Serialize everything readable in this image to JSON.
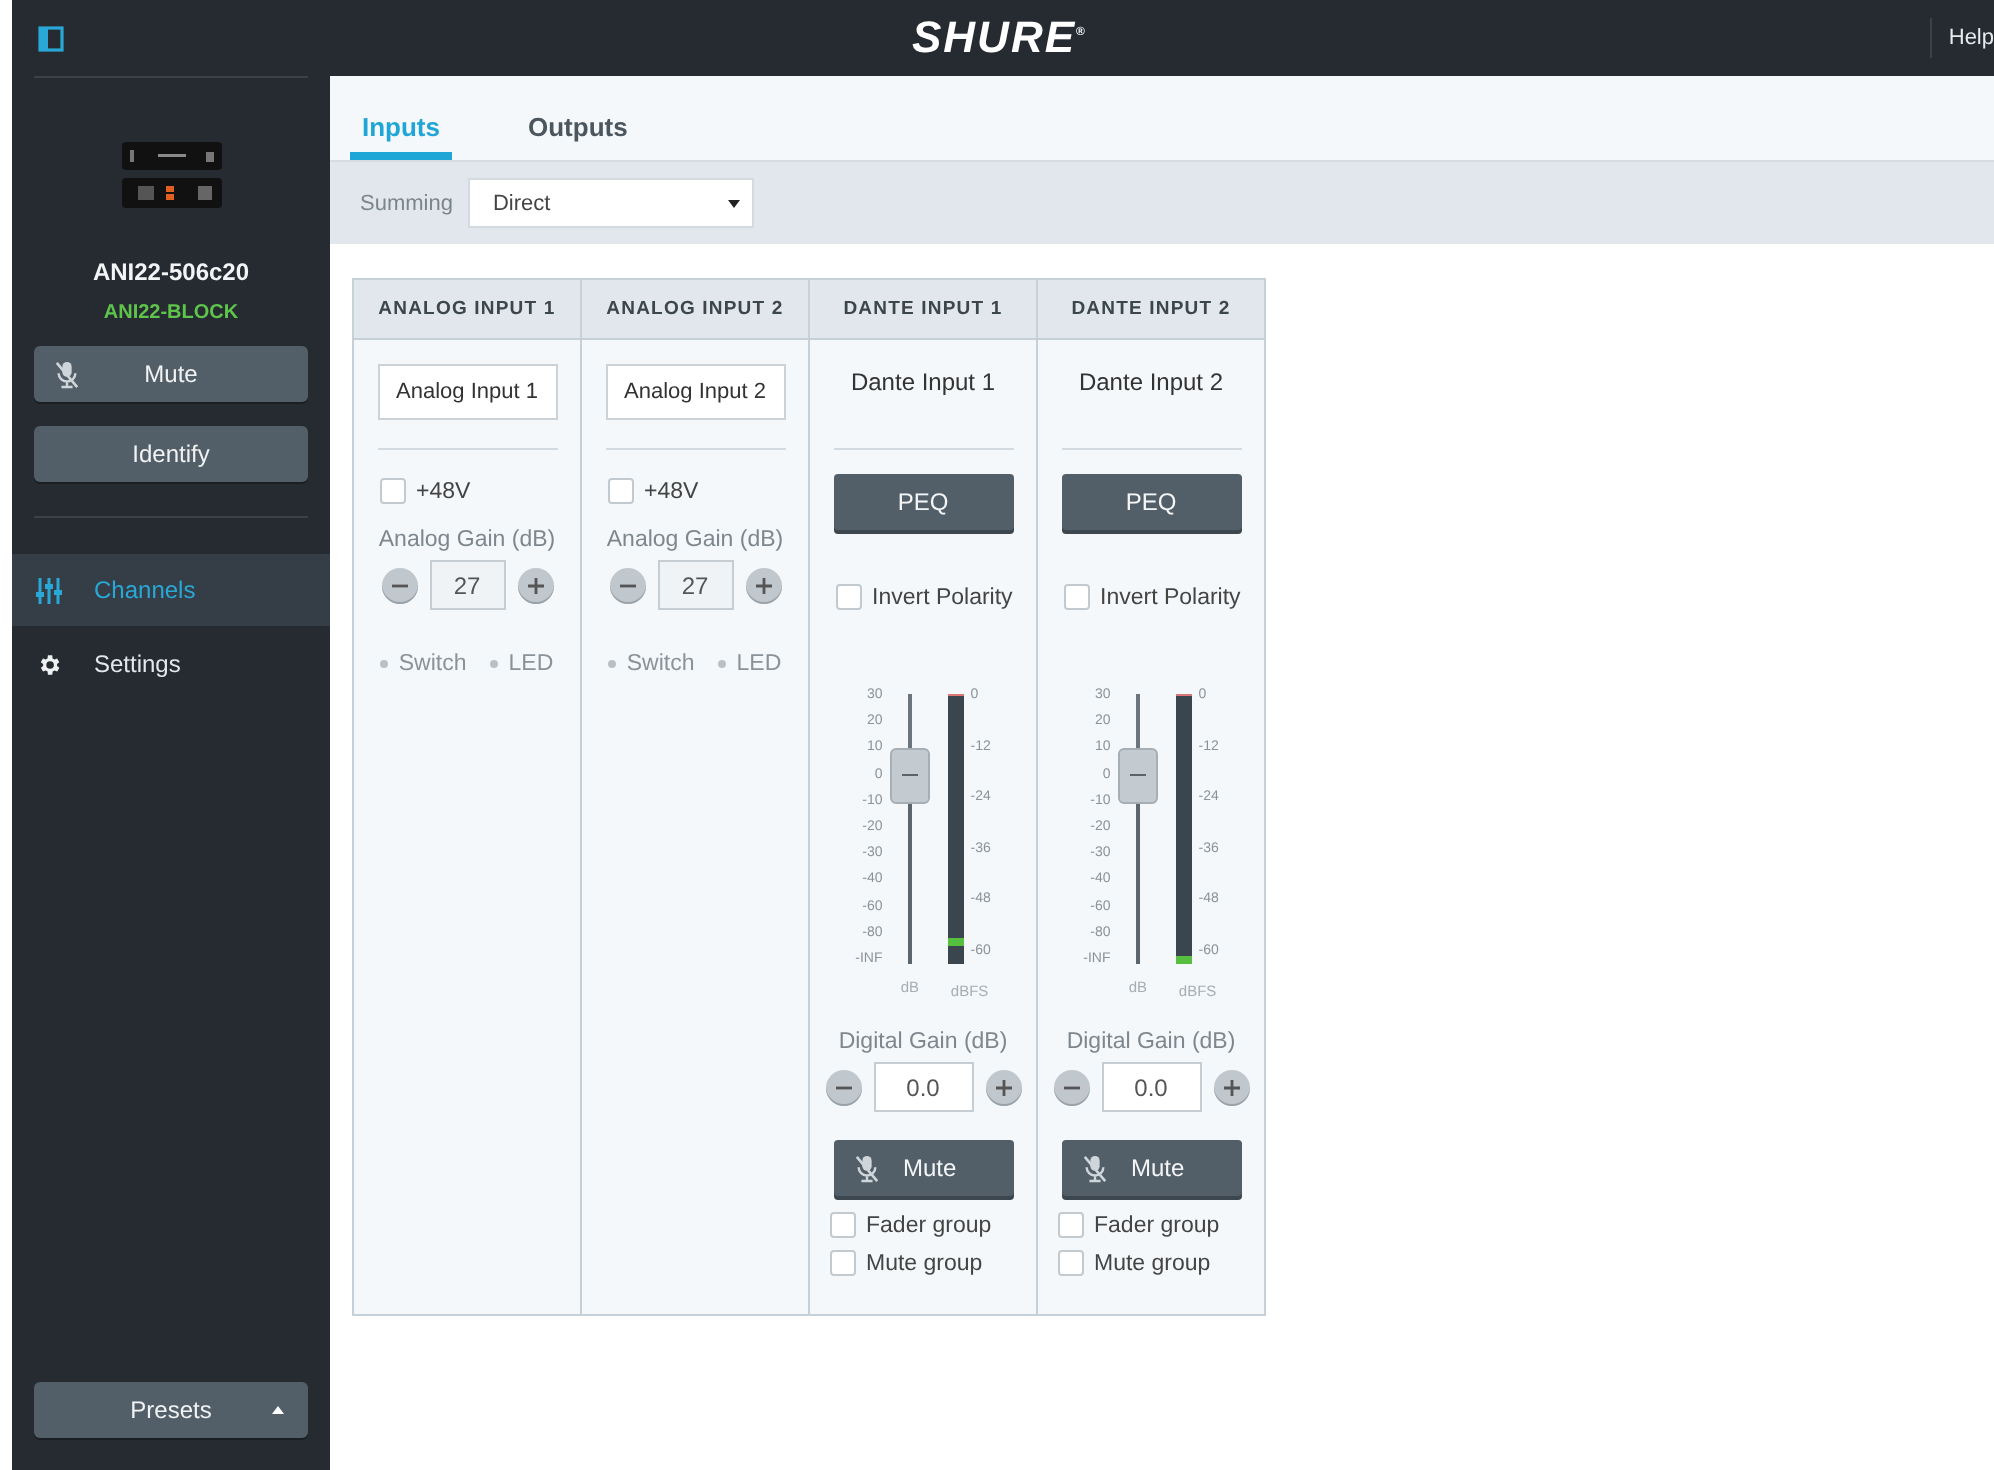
{
  "top_bar": {
    "logo": "SHURE$^{®}$",
    "help": "Help"
  },
  "sidebar": {
    "device_name": "ANI22-506c20",
    "device_model": "ANI22-BLOCK",
    "mute_button": "Mute",
    "identify_button": "Identify",
    "nav": [
      {
        "label": "Channels",
        "selected": true
      },
      {
        "label": "Settings",
        "selected": false
      }
    ],
    "presets_button": "Presets"
  },
  "tabs": [
    {
      "label": "Inputs",
      "selected": true
    },
    {
      "label": "Outputs",
      "selected": false
    }
  ],
  "summing": {
    "label": "Summing",
    "value": "Direct"
  },
  "channels": [
    {
      "kind": "analog",
      "header": "ANALOG INPUT 1",
      "name": "Analog Input 1",
      "phantom": {
        "label": "+48V",
        "checked": false
      },
      "gain_label": "Analog Gain (dB)",
      "gain": "27",
      "indicators": [
        "Switch",
        "LED"
      ]
    },
    {
      "kind": "analog",
      "header": "ANALOG INPUT 2",
      "name": "Analog Input 2",
      "phantom": {
        "label": "+48V",
        "checked": false
      },
      "gain_label": "Analog Gain (dB)",
      "gain": "27",
      "indicators": [
        "Switch",
        "LED"
      ]
    },
    {
      "kind": "dante",
      "header": "DANTE INPUT 1",
      "name": "Dante Input 1",
      "peq_button": "PEQ",
      "invert": {
        "label": "Invert Polarity",
        "checked": false
      },
      "fader": {
        "ticks": [
          "30",
          "20",
          "10",
          "0",
          "-10",
          "-20",
          "-30",
          "-40",
          "-60",
          "-80",
          "-INF"
        ],
        "unit": "dB",
        "level": 0.7
      },
      "meter": {
        "ticks": [
          "0",
          "-12",
          "-24",
          "-36",
          "-48",
          "-60"
        ],
        "unit": "dBFS",
        "level": 0.1
      },
      "gain_label": "Digital Gain (dB)",
      "gain": "0.0",
      "mute_button": "Mute",
      "groups": [
        {
          "label": "Fader group",
          "checked": false
        },
        {
          "label": "Mute group",
          "checked": false
        }
      ]
    },
    {
      "kind": "dante",
      "header": "DANTE INPUT 2",
      "name": "Dante Input 2",
      "peq_button": "PEQ",
      "invert": {
        "label": "Invert Polarity",
        "checked": false
      },
      "fader": {
        "ticks": [
          "30",
          "20",
          "10",
          "0",
          "-10",
          "-20",
          "-30",
          "-40",
          "-60",
          "-80",
          "-INF"
        ],
        "unit": "dB",
        "level": 0.7
      },
      "meter": {
        "ticks": [
          "0",
          "-12",
          "-24",
          "-36",
          "-48",
          "-60"
        ],
        "unit": "dBFS",
        "level": 0
      },
      "gain_label": "Digital Gain (dB)",
      "gain": "0.0",
      "mute_button": "Mute",
      "groups": [
        {
          "label": "Fader group",
          "checked": false
        },
        {
          "label": "Mute group",
          "checked": false
        }
      ]
    }
  ]
}
